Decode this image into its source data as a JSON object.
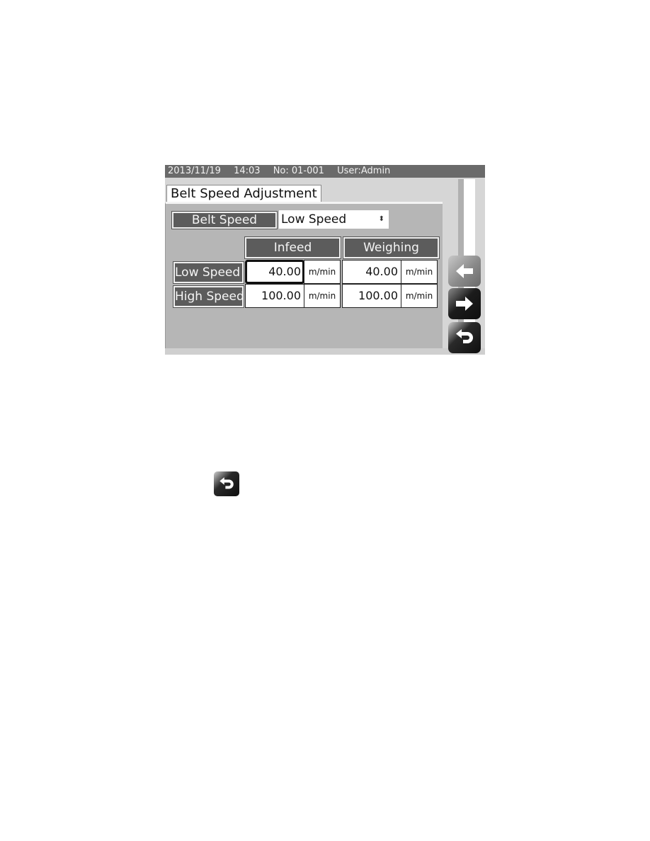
{
  "status_bar": {
    "date": "2013/11/19",
    "time": "14:03",
    "number": "No: 01-001",
    "user": "User:Admin"
  },
  "tab": {
    "title": "Belt Speed Adjustment"
  },
  "belt_speed": {
    "label": "Belt Speed",
    "selected": "Low Speed",
    "select_arrows": "⬍"
  },
  "table": {
    "columns": [
      "Infeed",
      "Weighing"
    ],
    "rows": [
      {
        "label": "Low Speed",
        "infeed_value": "40.00",
        "infeed_unit": "m/min",
        "weighing_value": "40.00",
        "weighing_unit": "m/min",
        "selected_cell": "infeed"
      },
      {
        "label": "High Speed",
        "infeed_value": "100.00",
        "infeed_unit": "m/min",
        "weighing_value": "100.00",
        "weighing_unit": "m/min"
      }
    ]
  },
  "nav": {
    "back_icon": "arrow-left-icon",
    "forward_icon": "arrow-right-icon",
    "return_icon": "return-icon"
  }
}
